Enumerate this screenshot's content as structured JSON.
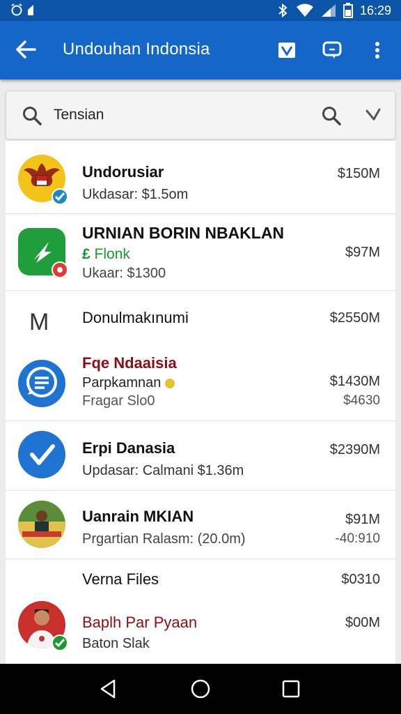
{
  "status": {
    "left_icons": [
      "alarm-icon",
      "signal-small-icon"
    ],
    "time": "16:29"
  },
  "appbar": {
    "title": "Undouhan Indonsia"
  },
  "search": {
    "value": "Tensian"
  },
  "items": [
    {
      "title": "Undorusiar",
      "subtitle": "Ukdasar: $1.5om",
      "amount": "$150M"
    },
    {
      "title": "URNIAN BORIN NBAKLAN",
      "tag": "Flonk",
      "subtitle": "Ukaar: $1300",
      "amount": "$97M"
    },
    {
      "letter": "M",
      "title": "Donulmakınumi",
      "amount": "$2550M"
    },
    {
      "title": "Fqe Ndaaisia",
      "subtitle": "Parpkamnan",
      "subtitle2": "Fragar Slo0",
      "amount": "$1430M",
      "amount2": "$4630"
    },
    {
      "title": "Erpi Danasia",
      "subtitle": "Updasar: Calmani $1.36m",
      "amount": "$2390M"
    },
    {
      "title": "Uanrain MKIAN",
      "subtitle": "Prgartian Ralasm: (20.0m)",
      "amount": "$91M",
      "amount2": "-40:910"
    },
    {
      "title": "Verna Files",
      "amount": "$0310"
    },
    {
      "title": "Baplh Par Pyaan",
      "subtitle": "Baton Slak",
      "amount": "$00M"
    }
  ],
  "colors": {
    "appbar": "#1466c8",
    "statusbar": "#0b55a8",
    "accent_red": "#8b0f14",
    "accent_green": "#1a9a2a"
  }
}
